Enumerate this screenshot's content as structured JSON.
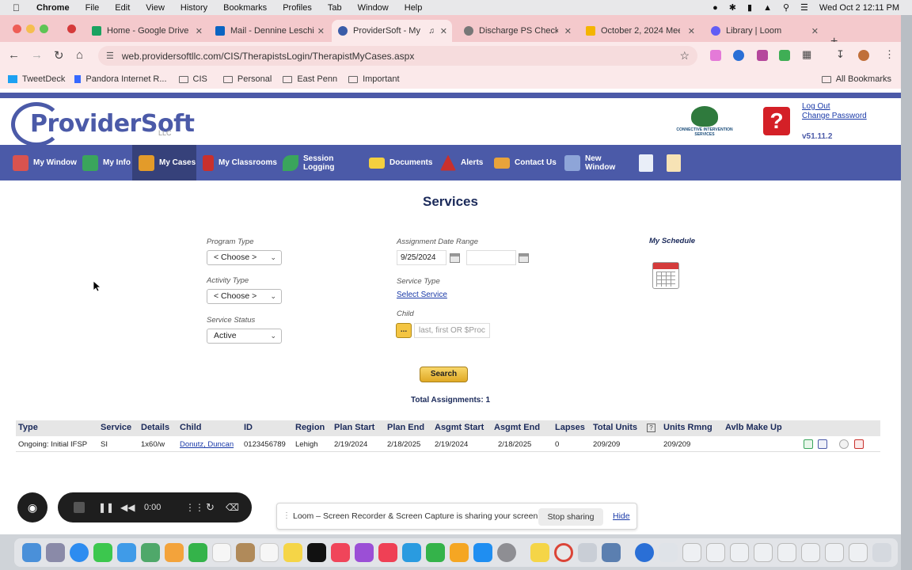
{
  "menubar": {
    "app": "Chrome",
    "items": [
      "File",
      "Edit",
      "View",
      "History",
      "Bookmarks",
      "Profiles",
      "Tab",
      "Window",
      "Help"
    ],
    "datetime": "Wed Oct 2  12:11 PM"
  },
  "tabs": [
    {
      "title": "Home - Google Drive",
      "color": "#1aa260"
    },
    {
      "title": "Mail - Dennine Leschi",
      "color": "#0a64c2"
    },
    {
      "title": "ProviderSoft - My",
      "color": "#3a5ca8",
      "active": true
    },
    {
      "title": "Discharge PS Checkli",
      "color": "#777777"
    },
    {
      "title": "October 2, 2024 Mee",
      "color": "#f4b400"
    },
    {
      "title": "Library | Loom",
      "color": "#625df5"
    }
  ],
  "address": {
    "url": "web.providersoftllc.com/CIS/TherapistsLogin/TherapistMyCases.aspx"
  },
  "bookmarks": {
    "items": [
      "TweetDeck",
      "Pandora Internet R...",
      "CIS",
      "Personal",
      "East Penn",
      "Important"
    ],
    "all": "All Bookmarks"
  },
  "header": {
    "logo": "ProviderSoft",
    "logo_suffix": "LLC",
    "partner_logo": "CONNECTIVE INTERVENTION SERVICES",
    "logout": "Log Out",
    "change_password": "Change Password",
    "version": "v51.11.2"
  },
  "nav": [
    {
      "label": "My Window",
      "icon": "my-window-icon",
      "color": "#d9534f"
    },
    {
      "label": "My Info",
      "icon": "my-info-icon",
      "color": "#3aa55c"
    },
    {
      "label": "My Cases",
      "icon": "briefcase-icon",
      "color": "#e39b2a",
      "active": true
    },
    {
      "label": "My Classrooms",
      "icon": "classroom-icon",
      "color": "#c9302c"
    },
    {
      "label": "Session Logging",
      "icon": "pen-icon",
      "color": "#3aa55c"
    },
    {
      "label": "Documents",
      "icon": "folder-icon",
      "color": "#f4d03f"
    },
    {
      "label": "Alerts",
      "icon": "alert-icon",
      "color": "#c9302c"
    },
    {
      "label": "Contact Us",
      "icon": "envelope-icon",
      "color": "#e8a33b"
    },
    {
      "label": "New Window",
      "icon": "new-window-icon",
      "color": "#8ea5d8"
    }
  ],
  "services": {
    "title": "Services",
    "program_type_label": "Program Type",
    "program_type_value": "< Choose >",
    "activity_type_label": "Activity Type",
    "activity_type_value": "< Choose >",
    "service_status_label": "Service Status",
    "service_status_value": "Active",
    "assignment_date_label": "Assignment Date Range",
    "date_from": "9/25/2024",
    "date_to": "",
    "service_type_label": "Service Type",
    "select_service": "Select Service",
    "child_label": "Child",
    "lookup_button": "...",
    "child_placeholder": "last, first OR $Proc",
    "my_schedule": "My Schedule",
    "search_button": "Search",
    "total": "Total Assignments: 1"
  },
  "table": {
    "headers": [
      "Type",
      "Service",
      "Details",
      "Child",
      "ID",
      "Region",
      "Plan Start",
      "Plan End",
      "Asgmt Start",
      "Asgmt End",
      "Lapses",
      "Total Units",
      "Units Rmng",
      "Avlb Make Up"
    ],
    "rows": [
      [
        "Ongoing: Initial IFSP",
        "SI",
        "1x60/w",
        "Donutz, Duncan",
        "0123456789",
        "Lehigh",
        "2/19/2024",
        "2/18/2025",
        "2/19/2024",
        "2/18/2025",
        "0",
        "209/209",
        "209/209",
        ""
      ]
    ]
  },
  "loom": {
    "timer": "0:00",
    "message": "Loom – Screen Recorder & Screen Capture is sharing your screen.",
    "stop": "Stop sharing",
    "hide": "Hide"
  }
}
